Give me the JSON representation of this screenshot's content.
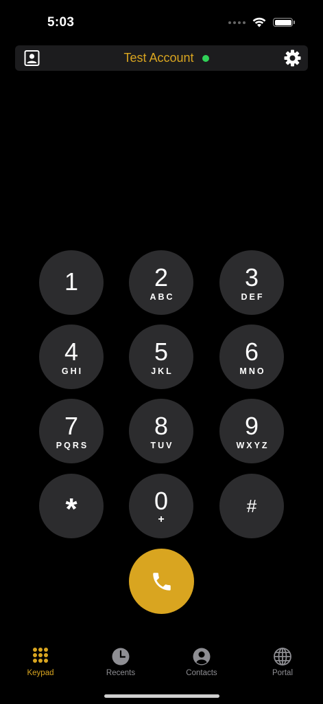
{
  "status_bar": {
    "time": "5:03"
  },
  "header": {
    "account_name": "Test Account",
    "status_color": "#30d158",
    "accent": "#d9a520"
  },
  "keypad": {
    "keys": [
      {
        "digit": "1",
        "letters": ""
      },
      {
        "digit": "2",
        "letters": "ABC"
      },
      {
        "digit": "3",
        "letters": "DEF"
      },
      {
        "digit": "4",
        "letters": "GHI"
      },
      {
        "digit": "5",
        "letters": "JKL"
      },
      {
        "digit": "6",
        "letters": "MNO"
      },
      {
        "digit": "7",
        "letters": "PQRS"
      },
      {
        "digit": "8",
        "letters": "TUV"
      },
      {
        "digit": "9",
        "letters": "WXYZ"
      },
      {
        "digit": "*",
        "letters": ""
      },
      {
        "digit": "0",
        "letters": "+"
      },
      {
        "digit": "#",
        "letters": ""
      }
    ]
  },
  "tabs": [
    {
      "label": "Keypad",
      "icon": "keypad-grid-icon",
      "active": true
    },
    {
      "label": "Recents",
      "icon": "clock-icon",
      "active": false
    },
    {
      "label": "Contacts",
      "icon": "person-circle-icon",
      "active": false
    },
    {
      "label": "Portal",
      "icon": "globe-icon",
      "active": false
    }
  ]
}
